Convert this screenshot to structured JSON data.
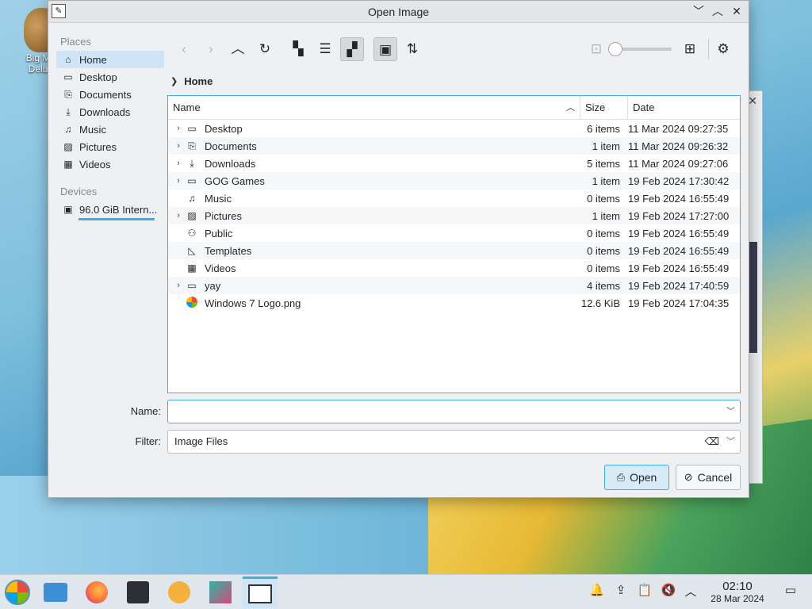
{
  "desktop": {
    "icon_label": "Big M... Delu..."
  },
  "dialog": {
    "title": "Open Image",
    "window_buttons": [
      "﹀",
      "︿",
      "✕"
    ]
  },
  "sidebar": {
    "places_header": "Places",
    "places": [
      {
        "label": "Home",
        "icon": "home-icon",
        "glyph": "⌂"
      },
      {
        "label": "Desktop",
        "icon": "desktop-icon",
        "glyph": "▭"
      },
      {
        "label": "Documents",
        "icon": "documents-icon",
        "glyph": "⎘"
      },
      {
        "label": "Downloads",
        "icon": "downloads-icon",
        "glyph": "⤓"
      },
      {
        "label": "Music",
        "icon": "music-icon",
        "glyph": "♫"
      },
      {
        "label": "Pictures",
        "icon": "pictures-icon",
        "glyph": "▨"
      },
      {
        "label": "Videos",
        "icon": "videos-icon",
        "glyph": "▦"
      }
    ],
    "devices_header": "Devices",
    "device": {
      "label": "96.0 GiB Intern...",
      "icon": "drive-icon",
      "glyph": "▣"
    }
  },
  "toolbar": {
    "back": "‹",
    "forward": "›",
    "up": "︿",
    "reload": "↻",
    "icons_view": "▚",
    "compact_view": "☰",
    "detail_view": "▞",
    "preview": "▣",
    "sort": "⇅",
    "zoom_out": "⊡",
    "zoom_in": "⊞",
    "options": "⚙"
  },
  "breadcrumb": {
    "chevron": "❯",
    "current": "Home"
  },
  "fileview": {
    "columns": {
      "name": "Name",
      "size": "Size",
      "date": "Date",
      "sort_indicator": "︿"
    },
    "rows": [
      {
        "expand": "›",
        "glyph": "▭",
        "icon": "desktop-icon",
        "name": "Desktop",
        "size": "6 items",
        "date": "11 Mar 2024 09:27:35"
      },
      {
        "expand": "›",
        "glyph": "⎘",
        "icon": "documents-icon",
        "name": "Documents",
        "size": "1 item",
        "date": "11 Mar 2024 09:26:32"
      },
      {
        "expand": "›",
        "glyph": "⤓",
        "icon": "downloads-icon",
        "name": "Downloads",
        "size": "5 items",
        "date": "11 Mar 2024 09:27:06"
      },
      {
        "expand": "›",
        "glyph": "▭",
        "icon": "folder-icon",
        "name": "GOG Games",
        "size": "1 item",
        "date": "19 Feb 2024 17:30:42"
      },
      {
        "expand": "",
        "glyph": "♫",
        "icon": "music-icon",
        "name": "Music",
        "size": "0 items",
        "date": "19 Feb 2024 16:55:49"
      },
      {
        "expand": "›",
        "glyph": "▨",
        "icon": "pictures-icon",
        "name": "Pictures",
        "size": "1 item",
        "date": "19 Feb 2024 17:27:00"
      },
      {
        "expand": "",
        "glyph": "⚇",
        "icon": "public-icon",
        "name": "Public",
        "size": "0 items",
        "date": "19 Feb 2024 16:55:49"
      },
      {
        "expand": "",
        "glyph": "◺",
        "icon": "templates-icon",
        "name": "Templates",
        "size": "0 items",
        "date": "19 Feb 2024 16:55:49"
      },
      {
        "expand": "",
        "glyph": "▦",
        "icon": "videos-icon",
        "name": "Videos",
        "size": "0 items",
        "date": "19 Feb 2024 16:55:49"
      },
      {
        "expand": "›",
        "glyph": "▭",
        "icon": "folder-icon",
        "name": "yay",
        "size": "4 items",
        "date": "19 Feb 2024 17:40:59"
      },
      {
        "expand": "",
        "glyph": "",
        "icon": "windows-logo-icon",
        "name": "Windows 7 Logo.png",
        "size": "12.6 KiB",
        "date": "19 Feb 2024 17:04:35"
      }
    ]
  },
  "form": {
    "name_label": "Name:",
    "name_value": "",
    "filter_label": "Filter:",
    "filter_value": "Image Files",
    "clear_glyph": "⌫",
    "dropdown_glyph": "﹀"
  },
  "buttons": {
    "open": "Open",
    "open_glyph": "⎙",
    "cancel": "Cancel",
    "cancel_glyph": "⊘"
  },
  "taskbar": {
    "tray_glyphs": {
      "notifications": "🔔",
      "updates": "⇪",
      "clipboard": "📋",
      "volume": "🔇",
      "expand": "︿"
    },
    "time": "02:10",
    "date": "28 Mar 2024",
    "show_desktop": "▭"
  },
  "colors": {
    "accent": "#3daee9",
    "selection": "#cfe4f5",
    "window_bg": "#eff0f1"
  }
}
